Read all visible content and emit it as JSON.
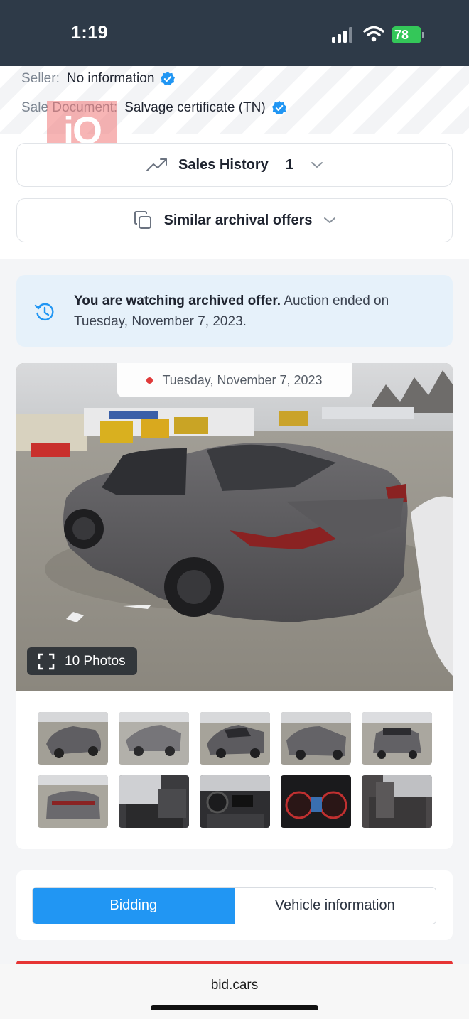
{
  "status_bar": {
    "time": "1:19",
    "battery": "78"
  },
  "seller": {
    "label": "Seller:",
    "value": "No information"
  },
  "sale_document": {
    "label": "Sale Document:",
    "value": "Salvage certificate (TN)"
  },
  "watermark": {
    "text": "iQ"
  },
  "sales_history": {
    "label": "Sales History",
    "count": "1"
  },
  "similar_offers": {
    "label": "Similar archival offers"
  },
  "notice": {
    "bold": "You are watching archived offer.",
    "text": " Auction ended on Tuesday, November 7, 2023."
  },
  "gallery": {
    "date": "Tuesday, November 7, 2023",
    "photos_label": "10 Photos"
  },
  "tabs": [
    {
      "label": "Bidding",
      "active": true
    },
    {
      "label": "Vehicle information",
      "active": false
    }
  ],
  "browser": {
    "url": "bid.cars"
  },
  "colors": {
    "accent": "#2196f3",
    "status_bar": "#2e3a48",
    "notice_bg": "#e6f1fa",
    "verified": "#2196f3",
    "alert": "#e63434"
  }
}
